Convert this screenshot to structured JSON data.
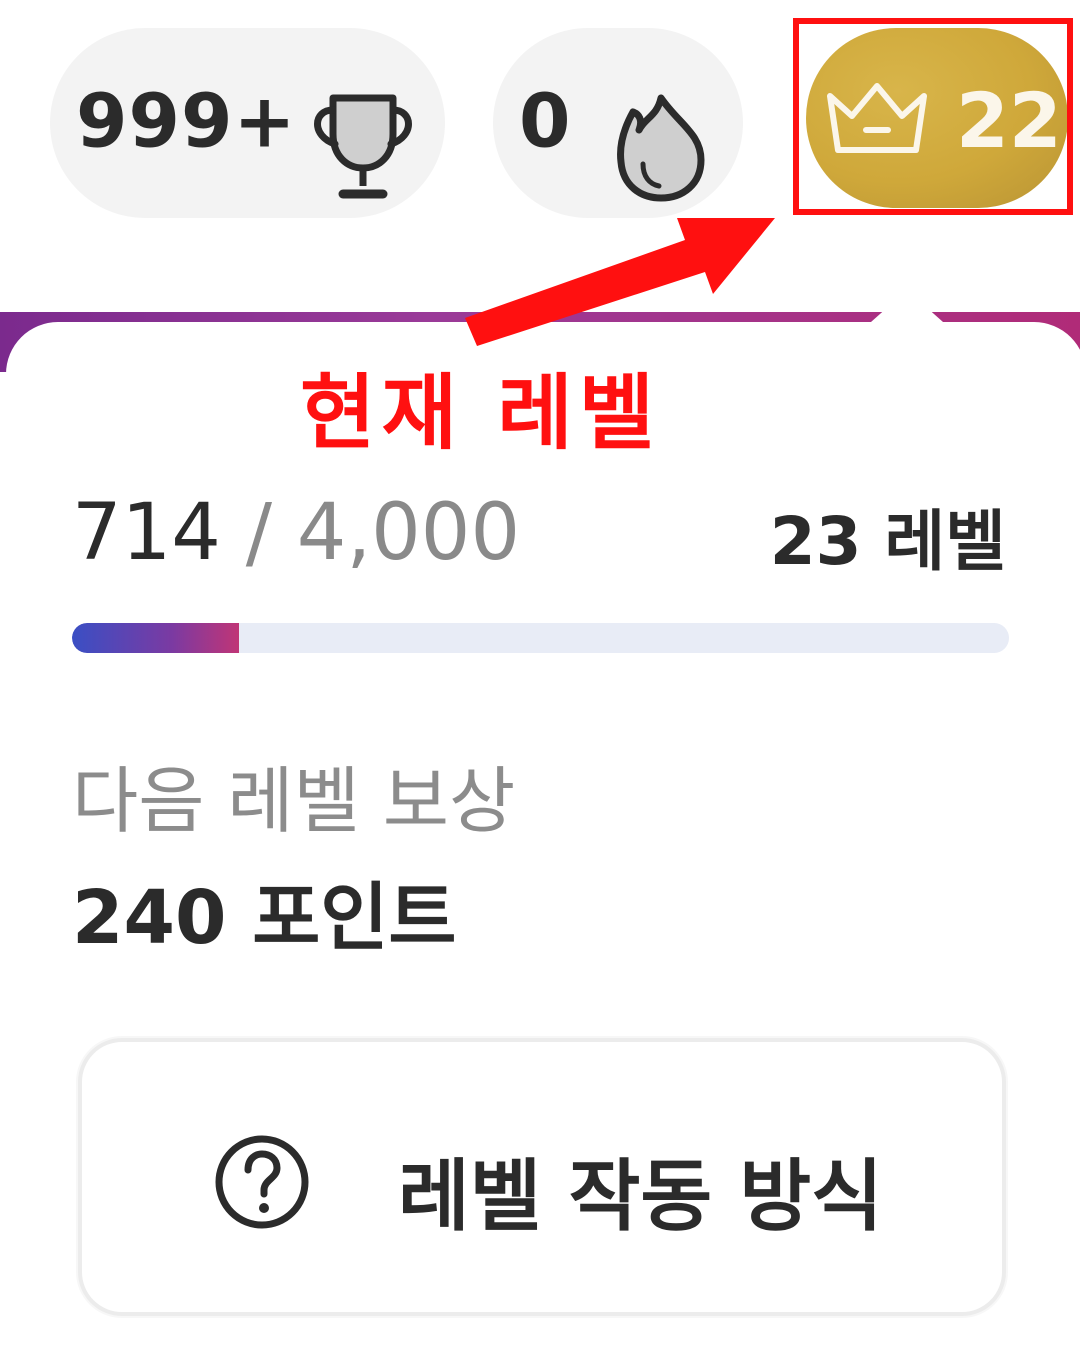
{
  "stats": {
    "trophies": "999+",
    "streak": "0",
    "current_level": "22"
  },
  "annotation": {
    "label": "현재 레벨"
  },
  "level_card": {
    "xp_current": "714",
    "xp_separator": "/",
    "xp_required": "4,000",
    "next_level_label": "23 레벨",
    "progress_fraction": 0.178,
    "reward_heading": "다음 레벨 보상",
    "reward_value": "240 포인트",
    "how_it_works_label": "레벨 작동 방식"
  },
  "icons": {
    "trophy": "trophy-icon",
    "streak": "flame-icon",
    "level": "crown-icon",
    "help": "question-circle-icon"
  },
  "colors": {
    "highlight": "#ff1010",
    "badge_gold": "#cfa83a",
    "progress_start": "#3a4fc4",
    "progress_end": "#c03576"
  }
}
